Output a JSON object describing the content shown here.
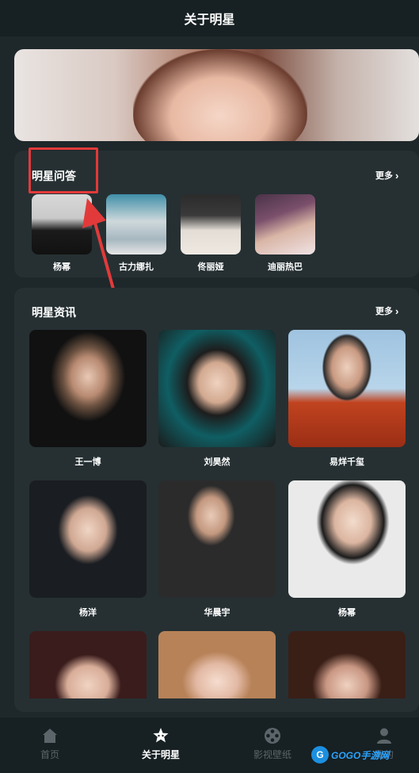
{
  "header": {
    "title": "关于明星"
  },
  "colors": {
    "background": "#1e272a",
    "card": "#263033",
    "accent_red": "#e23a3a",
    "tab_inactive": "#5c6569"
  },
  "qa_section": {
    "title": "明星问答",
    "more_label": "更多",
    "stars": [
      {
        "name": "杨幂"
      },
      {
        "name": "古力娜扎"
      },
      {
        "name": "佟丽娅"
      },
      {
        "name": "迪丽热巴"
      }
    ]
  },
  "news_section": {
    "title": "明星资讯",
    "more_label": "更多",
    "items": [
      {
        "name": "王一博"
      },
      {
        "name": "刘昊然"
      },
      {
        "name": "易烊千玺"
      },
      {
        "name": "杨洋"
      },
      {
        "name": "华晨宇"
      },
      {
        "name": "杨幂"
      },
      {
        "name": ""
      },
      {
        "name": ""
      },
      {
        "name": ""
      }
    ]
  },
  "tabbar": {
    "tabs": [
      {
        "label": "首页",
        "icon": "home-icon",
        "active": false
      },
      {
        "label": "关于明星",
        "icon": "star-icon",
        "active": true
      },
      {
        "label": "影视壁纸",
        "icon": "film-reel-icon",
        "active": false
      },
      {
        "label": "我的",
        "icon": "user-icon",
        "active": false
      }
    ]
  },
  "watermark": {
    "text": "GOGO手游网",
    "logo": "G"
  }
}
